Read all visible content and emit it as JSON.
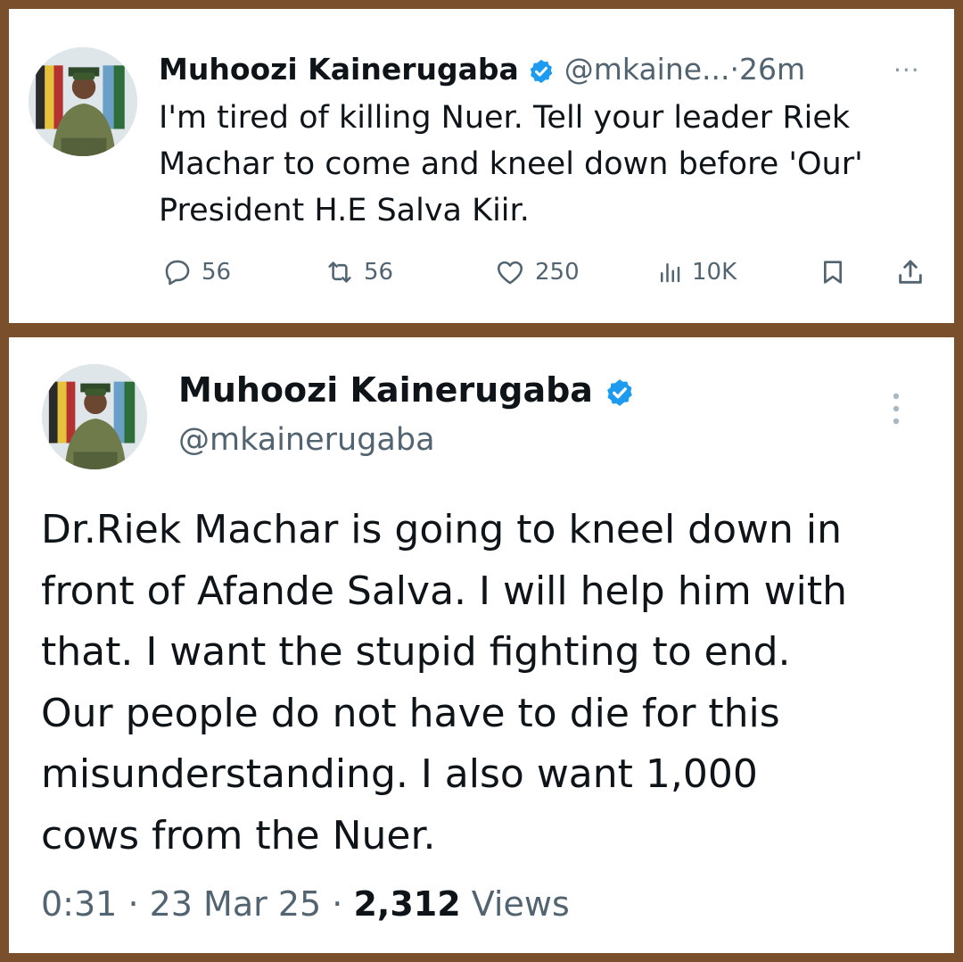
{
  "tweet1": {
    "name": "Muhoozi Kainerugaba",
    "handle": "@mkaine...",
    "separator": "·",
    "time": "26m",
    "more": "···",
    "text": "I'm tired of killing Nuer. Tell your leader Riek\nMachar to come and kneel down before  'Our'\nPresident H.E Salva Kiir.",
    "actions": {
      "replies": "56",
      "reposts": "56",
      "likes": "250",
      "views": "10K"
    }
  },
  "tweet2": {
    "name": "Muhoozi Kainerugaba",
    "handle": "@mkainerugaba",
    "text": "Dr.Riek Machar is going to kneel down in\nfront of Afande Salva. I will help him with\nthat. I want the stupid fighting to end.\nOur people do not have to die for this\nmisunderstanding. I also want 1,000\ncows from the Nuer.",
    "time": "0:31",
    "separator": "·",
    "date": "23 Mar 25",
    "views_count": "2,312",
    "views_label": "Views"
  },
  "colors": {
    "frame": "#7a4f2c",
    "verified": "#1d9bf0",
    "secondary_text": "#536471",
    "primary_text": "#0f1419"
  },
  "icons": [
    "verified-badge-icon",
    "reply-icon",
    "repost-icon",
    "like-icon",
    "views-icon",
    "bookmark-icon",
    "share-icon",
    "more-icon"
  ]
}
